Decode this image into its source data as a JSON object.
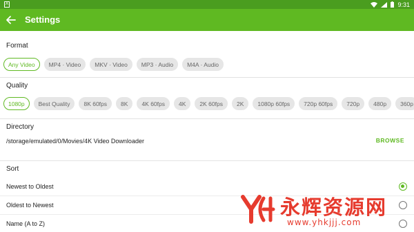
{
  "status_bar": {
    "left_icon_letter": "A",
    "time": "9:31"
  },
  "app_bar": {
    "title": "Settings"
  },
  "format": {
    "label": "Format",
    "options": [
      "Any Video",
      "MP4 · Video",
      "MKV · Video",
      "MP3 · Audio",
      "M4A · Audio"
    ],
    "selected": "Any Video"
  },
  "quality": {
    "label": "Quality",
    "options": [
      "1080p",
      "Best Quality",
      "8K 60fps",
      "8K",
      "4K 60fps",
      "4K",
      "2K 60fps",
      "2K",
      "1080p 60fps",
      "720p 60fps",
      "720p",
      "480p",
      "360p"
    ],
    "selected": "1080p"
  },
  "directory": {
    "label": "Directory",
    "path": "/storage/emulated/0/Movies/4K Video Downloader",
    "browse_label": "BROWSE"
  },
  "sort": {
    "label": "Sort",
    "options": [
      "Newest to Oldest",
      "Oldest to Newest",
      "Name (A to Z)"
    ],
    "selected": "Newest to Oldest"
  },
  "watermark": {
    "text_cn": "永辉资源网",
    "url": "www.yhkjjj.com"
  },
  "colors": {
    "accent": "#5fb922",
    "status_bar": "#4a9d1f",
    "watermark": "#e63b2e"
  }
}
